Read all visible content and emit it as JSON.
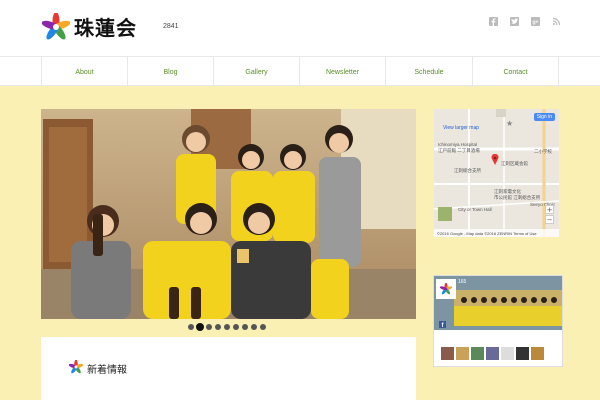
{
  "header": {
    "logo_text": "珠蓮会",
    "site_number": "2841",
    "social_icons": [
      "facebook-icon",
      "twitter-icon",
      "google-plus-icon",
      "rss-icon"
    ]
  },
  "nav": {
    "items": [
      "About",
      "Blog",
      "Gallery",
      "Newsletter",
      "Schedule",
      "Contact"
    ]
  },
  "slider": {
    "slide_count": 9,
    "active_index": 1
  },
  "news": {
    "title": "新着情報"
  },
  "map": {
    "view_larger": "View larger map",
    "sign_in": "Sign in",
    "labels": [
      "Ichinomiya Hospital",
      "江戸前鮨 二丁目酒場",
      "江刺区蔵会館",
      "江刺総合支所",
      "江刺家電文化",
      "市公民館 江刺総合支所",
      "City or Town Hall",
      "Seiryo Clinic",
      "二小学校"
    ],
    "footer": "©2016 Google - Map data ©2016 ZENRIN   Terms of Use",
    "zoom_in": "+",
    "zoom_out": "−"
  },
  "fb_widget": {
    "likes": "165"
  },
  "colors": {
    "background": "#fbf0b4",
    "nav_text": "#5b8f2a",
    "map_link": "#1a5fd6"
  }
}
